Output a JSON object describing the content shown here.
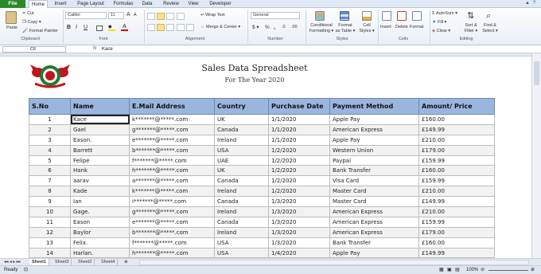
{
  "ribbon_tabs": {
    "file": "File",
    "home": "Home",
    "insert": "Insert",
    "page_layout": "Page Layout",
    "formulas": "Formulas",
    "data": "Data",
    "review": "Review",
    "view": "View",
    "developer": "Developer"
  },
  "clipboard": {
    "paste": "Paste",
    "cut": "Cut",
    "copy": "Copy ▾",
    "format_painter": "Format Painter",
    "group": "Clipboard"
  },
  "font": {
    "family": "Calibri",
    "size": "11",
    "group": "Font",
    "bold": "B",
    "italic": "I",
    "underline": "U",
    "grow": "A",
    "shrink": "A"
  },
  "alignment": {
    "wrap_text": "Wrap Text",
    "merge_center": "Merge & Center ▾",
    "group": "Alignment"
  },
  "number": {
    "format": "General",
    "currency": "$ ▾",
    "percent": "%",
    "comma": ",",
    "group": "Number"
  },
  "styles": {
    "conditional": "Conditional\nFormatting ▾",
    "format_table": "Format\nas Table ▾",
    "cell_styles": "Cell\nStyles ▾",
    "group": "Styles"
  },
  "cells": {
    "insert": "Insert",
    "delete": "Delete",
    "format": "Format",
    "group": "Cells"
  },
  "editing": {
    "autosum": "AutoSum ▾",
    "fill": "Fill ▾",
    "clear": "Clear ▾",
    "sort": "Sort &\nFilter ▾",
    "find": "Find &\nSelect ▾",
    "group": "Editing"
  },
  "formula_bar": {
    "cell_ref": "C6",
    "fx": "fx",
    "value": "Kace"
  },
  "sheet": {
    "title": "Sales Data Spreadsheet",
    "subtitle": "For The Year 2020",
    "headers": [
      "S.No",
      "Name",
      "E.Mail Address",
      "Country",
      "Purchase Date",
      "Payment Method",
      "Amount/ Price"
    ],
    "rows": [
      [
        "1",
        "Kace",
        "k*******@*****.com",
        "UK",
        "1/1/2020",
        "Apple Pay",
        "£160.00"
      ],
      [
        "2",
        "Gael",
        "g*******@*****.com",
        "Canada",
        "1/1/2020",
        "American Express",
        "£149.99"
      ],
      [
        "3",
        "Eason.",
        "e*******@*****.com",
        "Ireland",
        "1/1/2020",
        "Apple Pay",
        "£210.00"
      ],
      [
        "4",
        "Barrett",
        "b*******@*****.com",
        "USA",
        "1/2/2020",
        "Western Union",
        "£179.00"
      ],
      [
        "5",
        "Felipe",
        "f*******@*****.com",
        "UAE",
        "1/2/2020",
        "Paypal",
        "£159.99"
      ],
      [
        "6",
        "Hank",
        "h*******@*****.com",
        "UK",
        "1/2/2020",
        "Bank Transfer",
        "£160.00"
      ],
      [
        "7",
        "aarav",
        "a*******@*****.com",
        "Canada",
        "1/2/2020",
        "Visa Card",
        "£159.99"
      ],
      [
        "8",
        "Kade",
        "k*******@*****.com",
        "Ireland",
        "1/2/2020",
        "Master Card",
        "£210.00"
      ],
      [
        "9",
        "Ian",
        "i*******@*****.com",
        "Canada",
        "1/3/2020",
        "Master Card",
        "£149.99"
      ],
      [
        "10",
        "Gage.",
        "g*******@*****.com",
        "Ireland",
        "1/3/2020",
        "American Express",
        "£210.00"
      ],
      [
        "11",
        "Eason",
        "e*******@*****.com",
        "Canada",
        "1/3/2020",
        "American Express",
        "£159.99"
      ],
      [
        "12",
        "Baylor",
        "b*******@*****.com",
        "Ireland",
        "1/3/2020",
        "American Express",
        "£179.00"
      ],
      [
        "13",
        "Felix.",
        "f*******@*****.com",
        "USA",
        "1/3/2020",
        "Bank Transfer",
        "£160.00"
      ],
      [
        "14",
        "Harlan.",
        "h*******@*****.com",
        "USA",
        "1/4/2020",
        "Apple Pay",
        "£149.99"
      ]
    ]
  },
  "sheet_tabs": [
    "Sheet1",
    "Sheet3",
    "Sheet2",
    "Sheet4"
  ],
  "status": {
    "ready": "Ready",
    "zoom": "100%"
  },
  "colors": {
    "header_fill": "#9ab6de",
    "file_tab": "#2a8a2a",
    "logo_red": "#c0161d",
    "logo_green": "#1f7a32"
  }
}
